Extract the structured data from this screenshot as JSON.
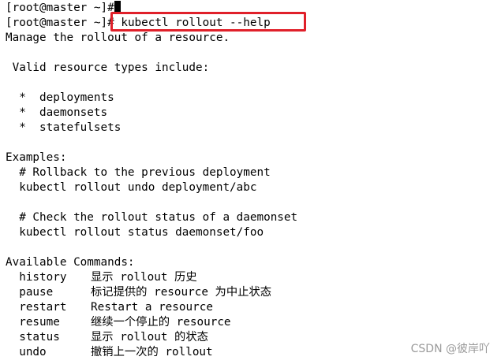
{
  "terminal": {
    "prompt_1": "[root@master ~]#",
    "prompt_2": "[root@master ~]#",
    "command": " kubectl rollout --help",
    "description": "Manage the rollout of a resource.",
    "valid_types_heading": " Valid resource types include:",
    "resource_types": [
      "  *  deployments",
      "  *  daemonsets",
      "  *  statefulsets"
    ],
    "examples_heading": "Examples:",
    "examples": [
      "  # Rollback to the previous deployment",
      "  kubectl rollout undo deployment/abc",
      "  # Check the rollout status of a daemonset",
      "  kubectl rollout status daemonset/foo"
    ],
    "available_commands_heading": "Available Commands:",
    "commands": [
      {
        "name": "  history",
        "desc": "显示 rollout 历史"
      },
      {
        "name": "  pause",
        "desc": "标记提供的 resource 为中止状态"
      },
      {
        "name": "  restart",
        "desc": "Restart a resource"
      },
      {
        "name": "  resume",
        "desc": "继续一个停止的 resource"
      },
      {
        "name": "  status",
        "desc": "显示 rollout 的状态"
      },
      {
        "name": "  undo",
        "desc": "撤销上一次的 rollout"
      }
    ]
  },
  "watermark": "CSDN @彼岸吖",
  "colors": {
    "background": "#ffffff",
    "text": "#000000",
    "highlight_border": "#e0202a",
    "watermark": "#9a9a9a"
  }
}
